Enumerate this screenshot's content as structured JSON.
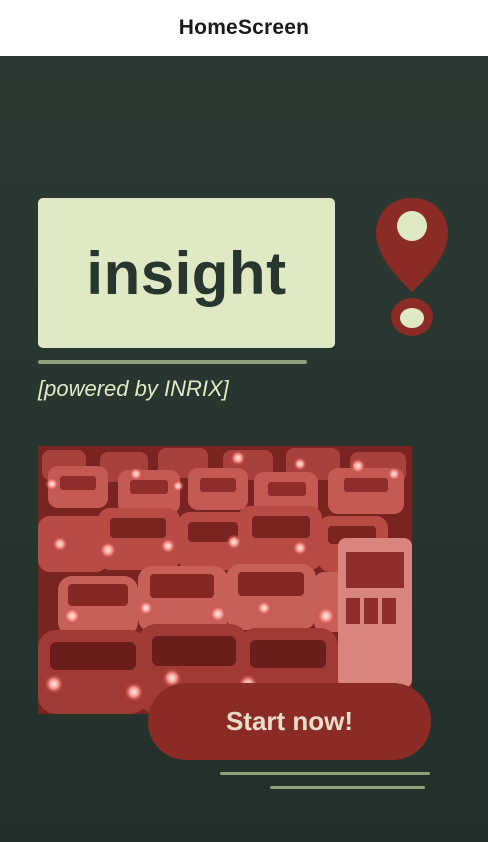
{
  "navbar": {
    "title": "HomeScreen"
  },
  "hero": {
    "logo_text": "insight",
    "tagline": "[powered by INRIX]"
  },
  "map_pin": {
    "icon": "map-pin-icon"
  },
  "photo": {
    "subject": "traffic-jam"
  },
  "cta": {
    "label": "Start now!"
  },
  "colors": {
    "background": "#2b3a33",
    "logo_box": "#dfeac4",
    "logo_text": "#27362f",
    "accent_red": "#8b2b26",
    "line_green": "#8fa07f"
  }
}
